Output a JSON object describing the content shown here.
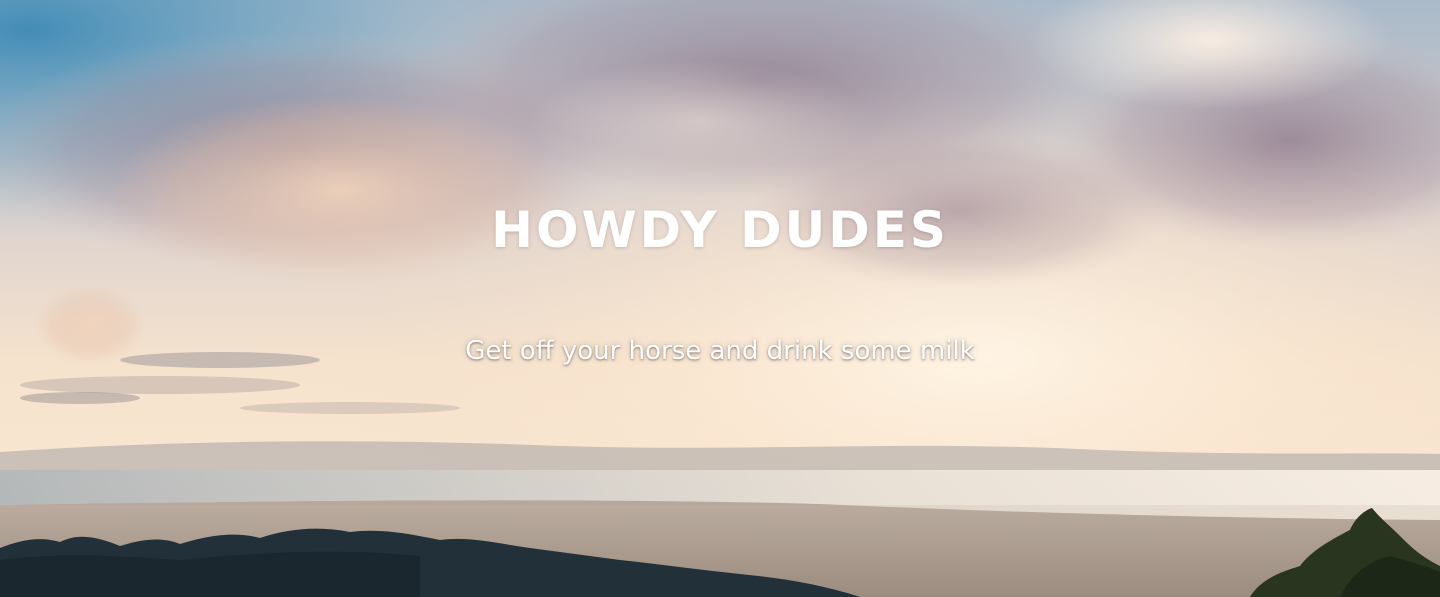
{
  "hero": {
    "title": "HOWDY DUDES",
    "subtitle": "Get off your horse and drink some milk",
    "background_description_icon": "landscape-photo",
    "colors": {
      "title_text": "#ffffff",
      "subtitle_text": "#ffffff",
      "sky_top_left": "#4a90b8",
      "haze_warm": "#f7e2c8",
      "tree_dark": "#1f2a30"
    }
  }
}
